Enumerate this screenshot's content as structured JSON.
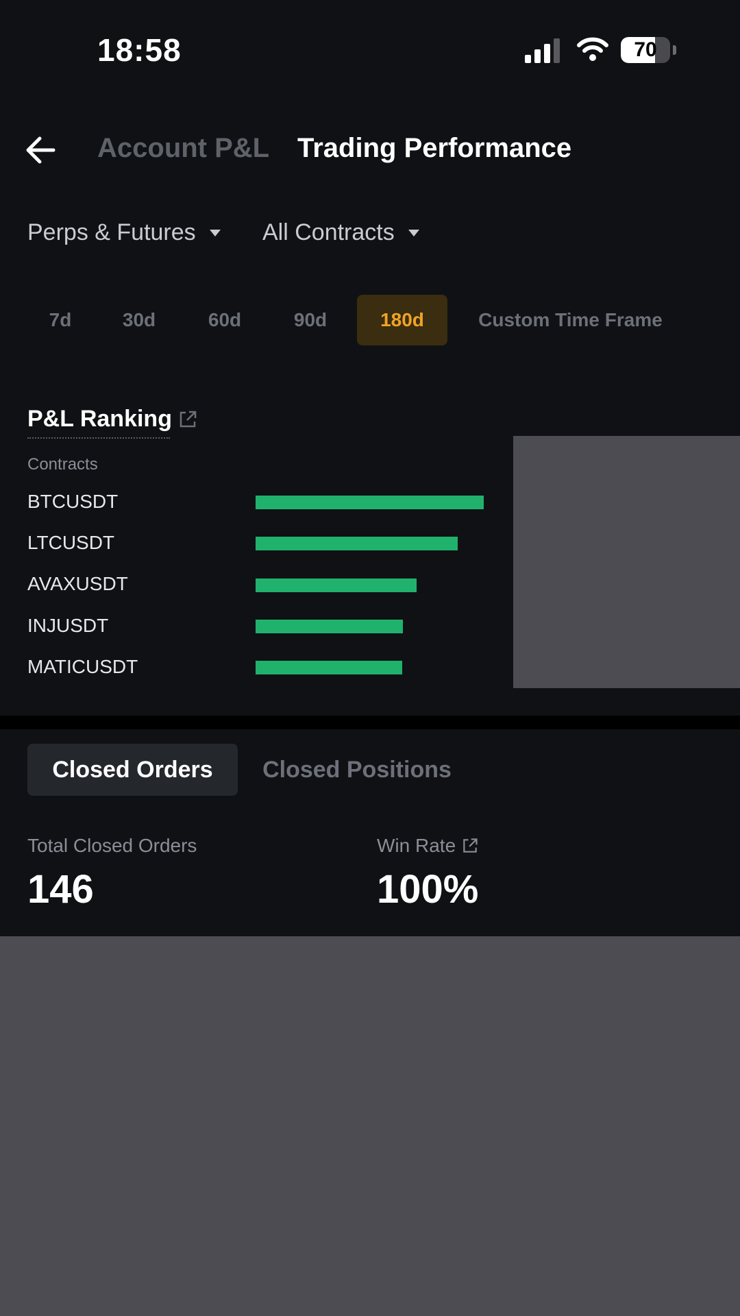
{
  "status_bar": {
    "time": "18:58",
    "battery": "70",
    "battery_level_percent": 70
  },
  "header": {
    "tabs": [
      {
        "label": "Account P&L",
        "active": false
      },
      {
        "label": "Trading Performance",
        "active": true
      }
    ]
  },
  "filters": {
    "product": "Perps & Futures",
    "contracts": "All Contracts"
  },
  "time_frames": [
    {
      "label": "7d",
      "active": false
    },
    {
      "label": "30d",
      "active": false
    },
    {
      "label": "60d",
      "active": false
    },
    {
      "label": "90d",
      "active": false
    },
    {
      "label": "180d",
      "active": true
    },
    {
      "label": "Custom Time Frame",
      "active": false
    }
  ],
  "ranking": {
    "title": "P&L Ranking",
    "column_label": "Contracts"
  },
  "chart_data": {
    "type": "bar",
    "orientation": "horizontal",
    "categories": [
      "BTCUSDT",
      "LTCUSDT",
      "AVAXUSDT",
      "INJUSDT",
      "MATICUSDT"
    ],
    "values": [
      100,
      88.6,
      70.6,
      64.7,
      64.3
    ],
    "unit": "relative (% of top bar)",
    "color": "#20b26c"
  },
  "closed_tabs": [
    {
      "label": "Closed Orders",
      "active": true
    },
    {
      "label": "Closed Positions",
      "active": false
    }
  ],
  "stats": {
    "total_closed_orders_label": "Total Closed Orders",
    "total_closed_orders_value": "146",
    "win_rate_label": "Win Rate",
    "win_rate_value": "100%"
  },
  "colors": {
    "background": "#101114",
    "accent": "#f0a325",
    "accent_bg": "#3a2d10",
    "positive": "#20b26c",
    "redaction": "#4c4c52"
  }
}
